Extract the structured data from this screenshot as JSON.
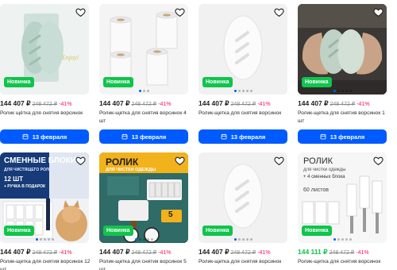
{
  "common": {
    "badge": "Новинка",
    "delivery": "13 февраля"
  },
  "cards": [
    {
      "price": "144 407 ₽",
      "old_price": "248 472 ₽",
      "discount": "-41%",
      "title": "Ролик щётка для снятия ворсинок"
    },
    {
      "price": "144 407 ₽",
      "old_price": "248 472 ₽",
      "discount": "-41%",
      "title": "Ролик-щетка для снятия ворсинок 4 шт"
    },
    {
      "price": "144 407 ₽",
      "old_price": "248 472 ₽",
      "discount": "-41%",
      "title": "Ролик-щетка для снятия ворсинок"
    },
    {
      "price": "144 407 ₽",
      "old_price": "248 472 ₽",
      "discount": "-41%",
      "title": "Ролик-щетка для снятия ворсинок 1 шт"
    },
    {
      "price": "144 407 ₽",
      "old_price": "248 472 ₽",
      "discount": "-41%",
      "title": "Ролик-щетка для снятия ворсинок 12 шт",
      "image_text": {
        "headline": "СМЕННЫЕ БЛОКИ",
        "sub": "ДЛЯ ЧИСТЯЩЕГО РОЛИКА",
        "count": "12 ШТ",
        "gift": "+ РУЧКА В ПОДАРОК"
      }
    },
    {
      "price": "144 407 ₽",
      "old_price": "248 472 ₽",
      "discount": "-41%",
      "title": "Ролик-щетка для снятия ворсинок 5 шт",
      "image_text": {
        "headline": "РОЛИК",
        "sub": "ДЛЯ ЧИСТКИ ОДЕЖДЫ",
        "count": "5",
        "sheets": "60"
      }
    },
    {
      "price": "144 407 ₽",
      "old_price": "248 472 ₽",
      "discount": "-41%",
      "title": "Ролик-щетка для снятия ворсинок"
    },
    {
      "price": "144 111 ₽",
      "old_price": "248 472 ₽",
      "discount": "-41%",
      "title": "Ролик-щетка для снятия ворсинок",
      "image_text": {
        "headline": "РОЛИК",
        "sub": "для чистки одежды",
        "gift": "+ 4 сменных блока",
        "sheets": "60 листов"
      }
    }
  ],
  "colors": {
    "accent": "#005bff",
    "badge": "#10c44c",
    "discount": "#f91155",
    "green_price": "#10c44c"
  }
}
